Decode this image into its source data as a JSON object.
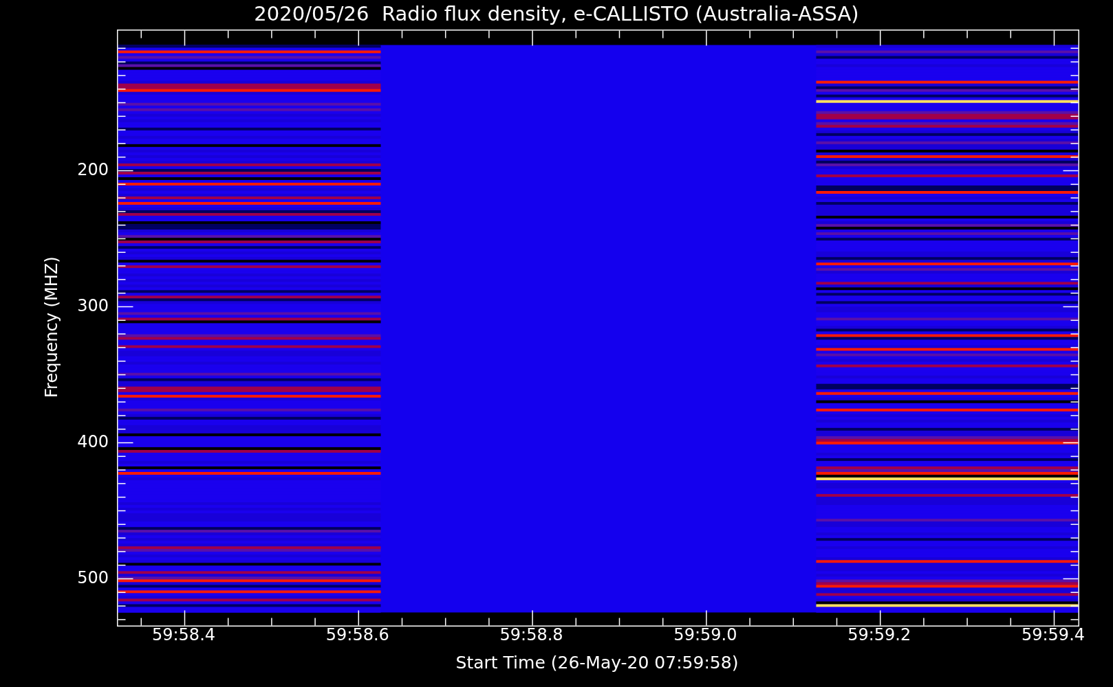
{
  "title": "2020/05/26  Radio flux density, e-CALLISTO (Australia-ASSA)",
  "ylabel": "Frequency (MHZ)",
  "xlabel": "Start Time (26-May-20 07:59:58)",
  "yticks": [
    "200",
    "300",
    "400",
    "500"
  ],
  "xticks": [
    "59:58.4",
    "59:58.6",
    "59:58.8",
    "59:59.0",
    "59:59.2",
    "59:59.4"
  ]
}
